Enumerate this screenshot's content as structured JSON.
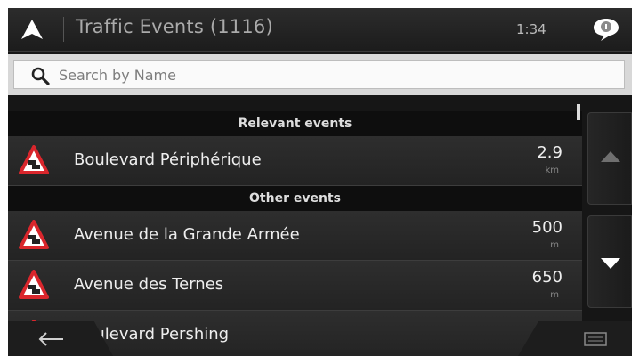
{
  "header": {
    "title": "Traffic Events (1116)",
    "clock": "1:34",
    "nav_icon": "navigation-arrow-icon",
    "message_icon": "message-bubble-icon"
  },
  "search": {
    "placeholder": "Search by Name",
    "icon": "search-icon"
  },
  "sections": {
    "relevant": "Relevant events",
    "other": "Other events"
  },
  "events": [
    {
      "name": "Boulevard Périphérique",
      "distance": "2.9",
      "unit": "km"
    },
    {
      "name": "Avenue de la Grande Armée",
      "distance": "500",
      "unit": "m"
    },
    {
      "name": "Avenue des Ternes",
      "distance": "650",
      "unit": "m"
    },
    {
      "name": "Boulevard Pershing"
    }
  ],
  "controls": {
    "scroll_up_icon": "triangle-up-icon",
    "scroll_down_icon": "triangle-down-icon",
    "back_icon": "arrow-left-icon",
    "menu_icon": "menu-icon"
  },
  "colors": {
    "background": "#161616",
    "accent_warning": "#d9262c",
    "text": "#eeeeee"
  }
}
